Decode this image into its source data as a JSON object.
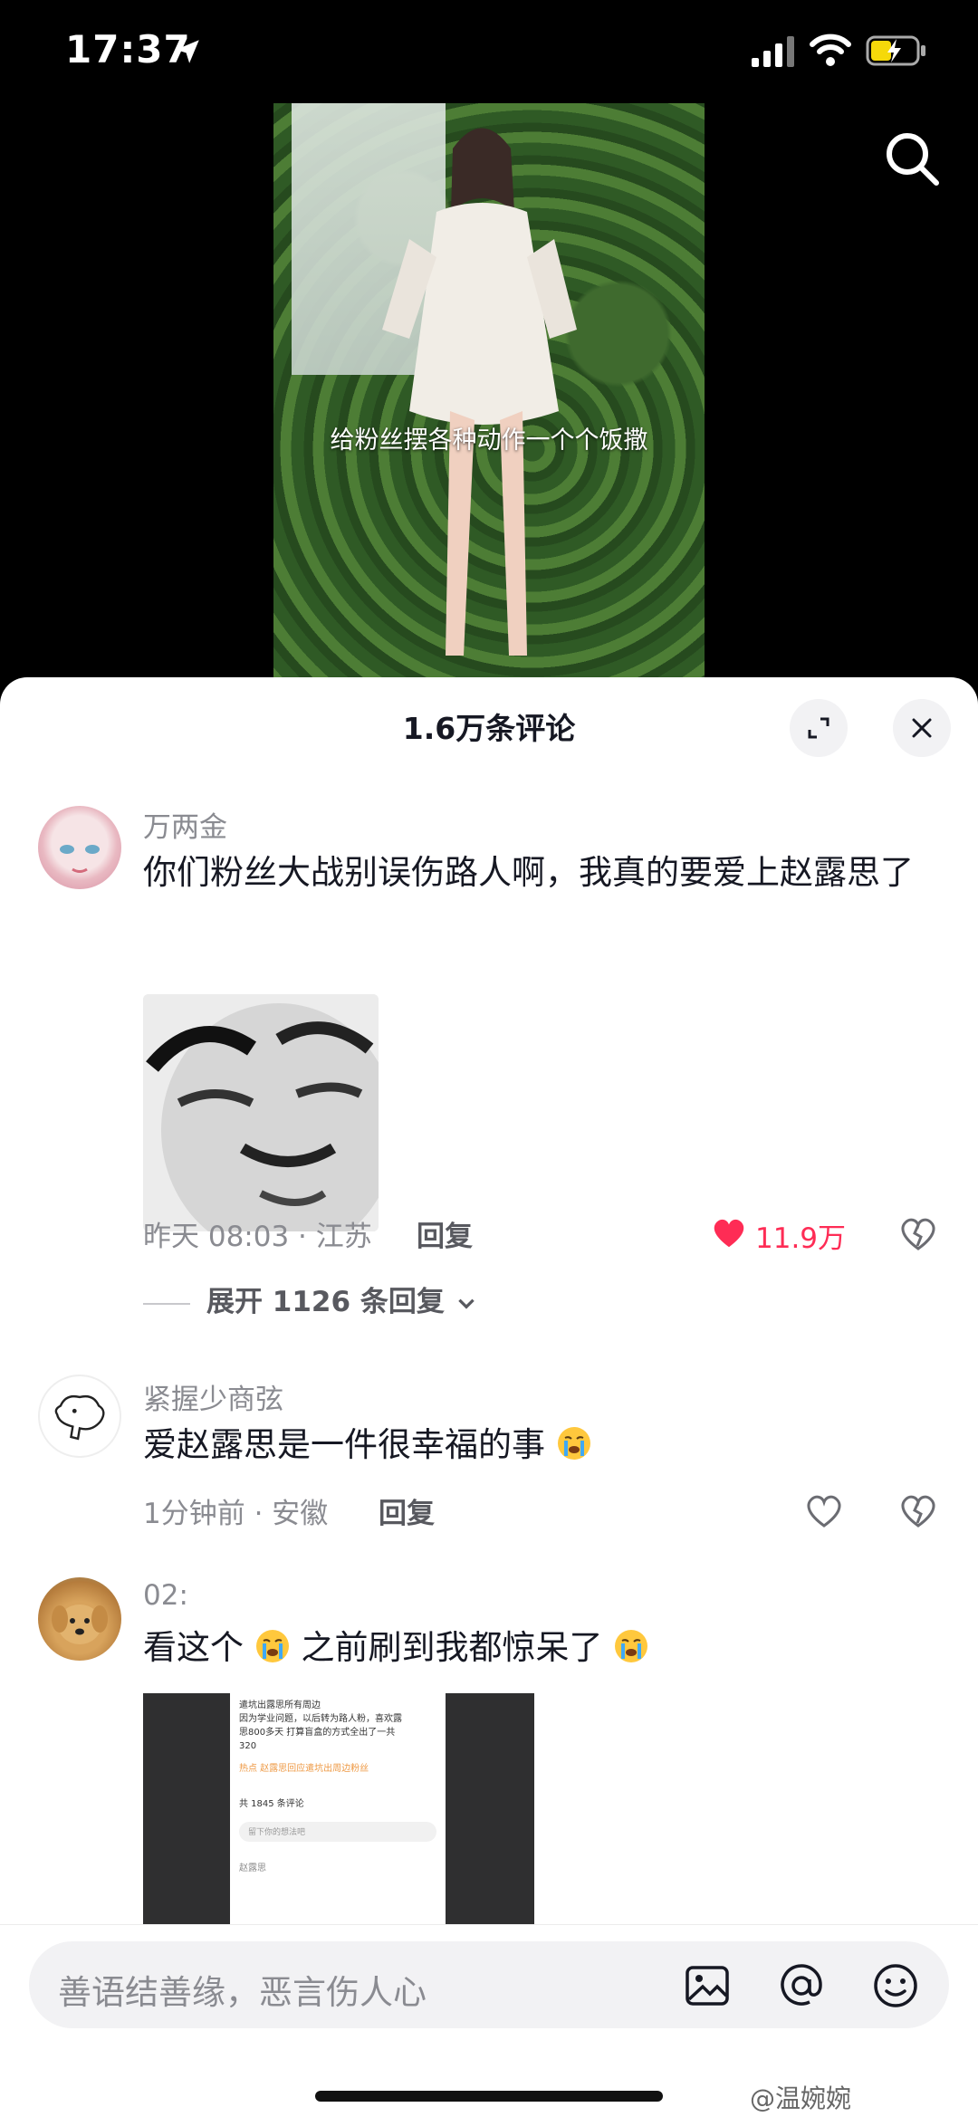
{
  "status_bar": {
    "time": "17:37",
    "icons": [
      "location-arrow-icon",
      "signal-icon",
      "wifi-icon",
      "battery-charging-icon"
    ]
  },
  "video": {
    "caption": "给粉丝摆各种动作一个个饭撒"
  },
  "comments_sheet": {
    "title": "1.6万条评论",
    "comments": [
      {
        "username": "万两金",
        "text": "你们粉丝大战别误伤路人啊，我真的要爱上赵露思了",
        "meta": "昨天 08:03 · 江苏",
        "reply_label": "回复",
        "like_count": "11.9万",
        "liked": true,
        "expand_label": "展开 1126 条回复"
      },
      {
        "username": "紧握少商弦",
        "text": "爱赵露思是一件很幸福的事",
        "meta": "1分钟前 · 安徽",
        "reply_label": "回复"
      },
      {
        "username": "02:",
        "text_part1": "看这个",
        "text_part2": " 之前刷到我都惊呆了",
        "screenshot": {
          "lines": [
            "遣坑出露思所有周边",
            "因为学业问题，以后转为路人粉，喜欢露",
            "思800多天 打算盲盒的方式全出了一共",
            "320"
          ],
          "hot": "热点 赵露思回应遣坑出周边粉丝",
          "count": "共 1845 条评论",
          "input": "留下你的想法吧",
          "user": "赵露思"
        }
      }
    ]
  },
  "input_bar": {
    "placeholder": "善语结善缘，恶言伤人心"
  },
  "watermark": "@温婉婉",
  "colors": {
    "accent_like": "#fe2c55",
    "text_primary": "#161823",
    "text_secondary": "#8a8b91"
  }
}
